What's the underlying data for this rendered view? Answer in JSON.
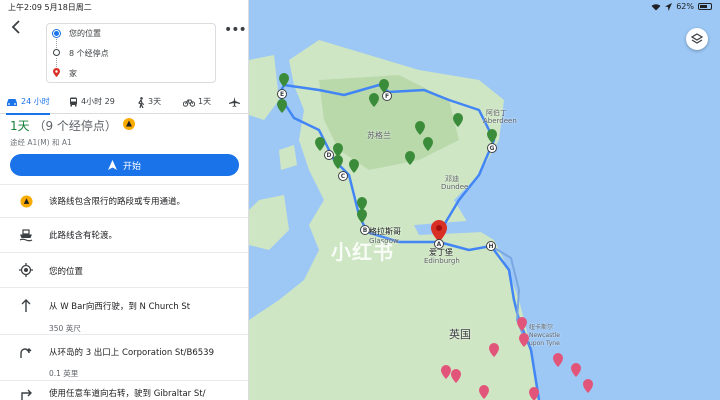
{
  "status": {
    "time": "上午2:09",
    "date": "5月18日周二",
    "battery": "62%"
  },
  "stops": {
    "origin": "您的位置",
    "middle": "8 个经停点",
    "destination": "家"
  },
  "modes": [
    {
      "label": "24 小时",
      "icon": "car-icon"
    },
    {
      "label": "4小时 29",
      "icon": "transit-icon"
    },
    {
      "label": "3天",
      "icon": "walk-icon"
    },
    {
      "label": "1天",
      "icon": "bike-icon"
    },
    {
      "label": "",
      "icon": "flight-icon"
    }
  ],
  "summary": {
    "duration": "1天",
    "stops_note": "（9 个经停点）",
    "via": "途经 A1(M) 和 A1",
    "start_label": "开始"
  },
  "notices": [
    {
      "icon": "warning-icon",
      "text": "该路线包含限行的路段或专用通道。"
    },
    {
      "icon": "ferry-icon",
      "text": "此路线含有轮渡。"
    }
  ],
  "steps": [
    {
      "icon": "location-icon",
      "text": "您的位置",
      "sub": ""
    },
    {
      "icon": "arrow-up-icon",
      "text": "从 W Bar向西行驶，到 N Church St",
      "sub": "350 英尺"
    },
    {
      "icon": "roundabout-icon",
      "text": "从环岛的 3 出口上 Corporation St/B6539",
      "sub": "0.1 英里"
    },
    {
      "icon": "turn-right-icon",
      "text": "使用任意车道向右转，驶到 Gibraltar St/",
      "sub": ""
    }
  ],
  "map": {
    "labels": {
      "scotland": "苏格兰",
      "aberdeen_cn": "阿伯丁",
      "aberdeen_en": "Aberdeen",
      "dundee_cn": "邓迪",
      "dundee_en": "Dundee",
      "glasgow": "格拉斯哥",
      "glasgow_en": "Glasgow",
      "edinburgh_cn": "爱丁堡",
      "edinburgh_en": "Edinburgh",
      "uk": "英国",
      "newcastle_cn": "纽卡斯尔",
      "newcastle_en": "Newcastle",
      "tyne": "upon Tyne"
    },
    "waypoints": [
      "A",
      "B",
      "C",
      "D",
      "E",
      "F",
      "G",
      "H"
    ],
    "watermark": "小红书",
    "colors": {
      "land": "#cfe6c4",
      "water": "#9dc8f5",
      "route": "#4285f4",
      "marker_green": "#3b8c3a",
      "marker_pink": "#e2557a",
      "dest_red": "#d93025"
    }
  }
}
